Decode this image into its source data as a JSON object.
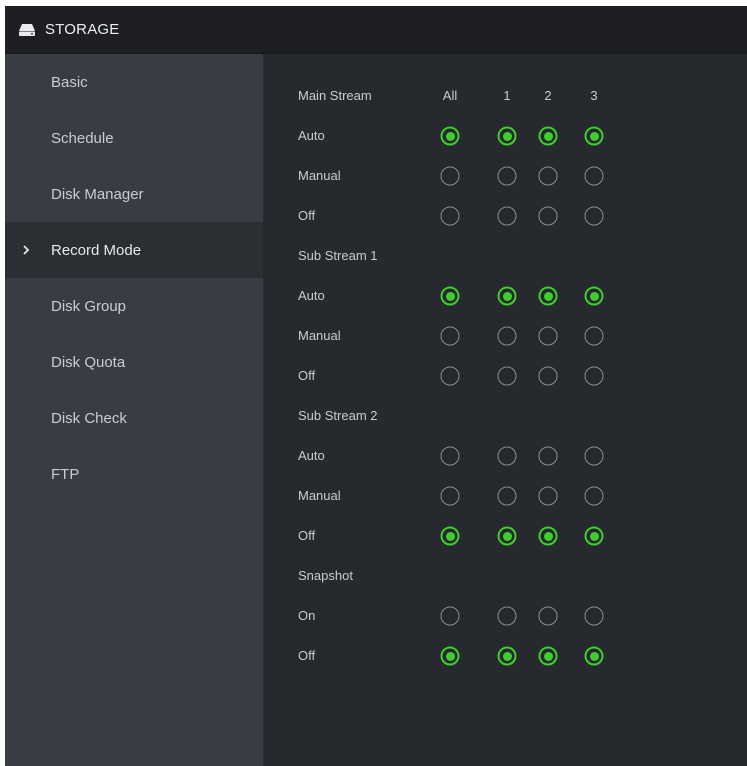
{
  "title": "STORAGE",
  "sidebar": {
    "items": [
      {
        "label": "Basic",
        "active": false
      },
      {
        "label": "Schedule",
        "active": false
      },
      {
        "label": "Disk Manager",
        "active": false
      },
      {
        "label": "Record Mode",
        "active": true
      },
      {
        "label": "Disk Group",
        "active": false
      },
      {
        "label": "Disk Quota",
        "active": false
      },
      {
        "label": "Disk Check",
        "active": false
      },
      {
        "label": "FTP",
        "active": false
      }
    ]
  },
  "main": {
    "columns": [
      "All",
      "1",
      "2",
      "3"
    ],
    "accent_color": "#3fcf2c",
    "sections": [
      {
        "title": "Main Stream",
        "options": [
          {
            "label": "Auto",
            "selected": [
              true,
              true,
              true,
              true
            ]
          },
          {
            "label": "Manual",
            "selected": [
              false,
              false,
              false,
              false
            ]
          },
          {
            "label": "Off",
            "selected": [
              false,
              false,
              false,
              false
            ]
          }
        ]
      },
      {
        "title": "Sub Stream 1",
        "options": [
          {
            "label": "Auto",
            "selected": [
              true,
              true,
              true,
              true
            ]
          },
          {
            "label": "Manual",
            "selected": [
              false,
              false,
              false,
              false
            ]
          },
          {
            "label": "Off",
            "selected": [
              false,
              false,
              false,
              false
            ]
          }
        ]
      },
      {
        "title": "Sub Stream 2",
        "options": [
          {
            "label": "Auto",
            "selected": [
              false,
              false,
              false,
              false
            ]
          },
          {
            "label": "Manual",
            "selected": [
              false,
              false,
              false,
              false
            ]
          },
          {
            "label": "Off",
            "selected": [
              true,
              true,
              true,
              true
            ]
          }
        ]
      },
      {
        "title": "Snapshot",
        "options": [
          {
            "label": "On",
            "selected": [
              false,
              false,
              false,
              false
            ]
          },
          {
            "label": "Off",
            "selected": [
              true,
              true,
              true,
              true
            ]
          }
        ]
      }
    ]
  }
}
